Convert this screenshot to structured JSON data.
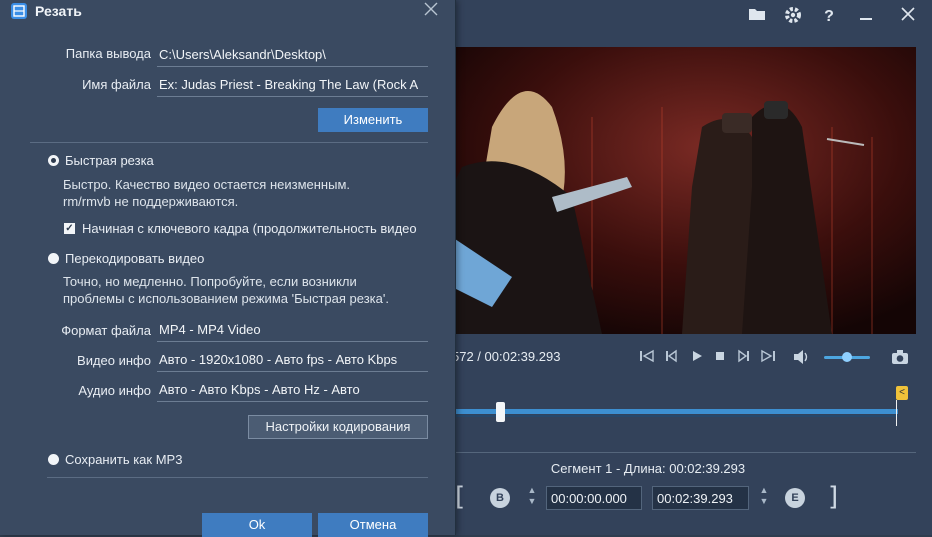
{
  "app": {
    "icons": [
      "folder-icon",
      "gear-icon",
      "help-icon",
      "minimize-icon",
      "close-icon"
    ],
    "timecode": "572 / 00:02:39.293",
    "segment_label": "Сегмент 1 - Длина: 00:02:39.293",
    "start_time": "00:00:00.000",
    "end_time": "00:02:39.293",
    "start_marker": "B",
    "end_marker": "E",
    "end_flag": "<",
    "playback_controls": [
      "skip-to-start-icon",
      "prev-frame-icon",
      "play-icon",
      "stop-icon",
      "next-frame-icon",
      "skip-to-end-icon",
      "volume-icon",
      "snapshot-icon"
    ],
    "volume_level": 0.5
  },
  "dialog": {
    "title": "Резать",
    "output_folder_label": "Папка вывода",
    "output_folder_value": "C:\\Users\\Aleksandr\\Desktop\\",
    "filename_label": "Имя файла",
    "filename_value": "Ex: Judas Priest - Breaking The Law (Rock A",
    "change_button": "Изменить",
    "fast_cut_label": "Быстрая резка",
    "fast_cut_desc_1": "Быстро. Качество видео остается неизменным.",
    "fast_cut_desc_2": "rm/rmvb не поддерживаются.",
    "keyframe_label": "Начиная с ключевого кадра (продолжительность видео",
    "reencode_label": "Перекодировать видео",
    "reencode_desc_1": "Точно, но медленно. Попробуйте, если возникли",
    "reencode_desc_2": "проблемы с использованием режима 'Быстрая резка'.",
    "format_label": "Формат файла",
    "format_value": "MP4 - MP4 Video",
    "video_info_label": "Видео инфо",
    "video_info_value": "Авто - 1920x1080 - Авто fps - Авто Kbps",
    "audio_info_label": "Аудио инфо",
    "audio_info_value": "Авто - Авто Kbps - Авто Hz - Авто",
    "encode_settings_button": "Настройки кодирования",
    "mp3_label": "Сохранить как MP3",
    "ok_button": "Ok",
    "cancel_button": "Отмена"
  }
}
